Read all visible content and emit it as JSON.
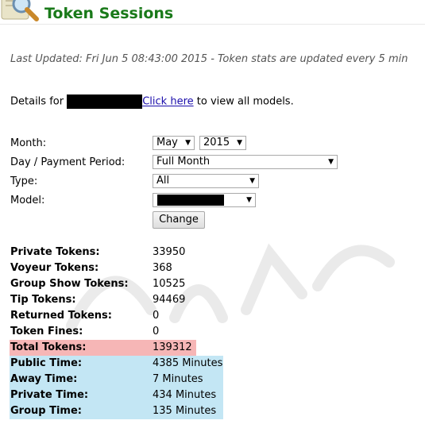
{
  "header": {
    "title": "Token Sessions",
    "icon": "magnifier-icon"
  },
  "last_updated": "Last Updated: Fri Jun 5 08:43:00 2015 - Token stats are updated every 5 min",
  "details": {
    "prefix": "Details for",
    "link_text": "Click here",
    "suffix": " to view all models."
  },
  "form": {
    "month_label": "Month:",
    "month_value": "May",
    "year_value": "2015",
    "period_label": "Day / Payment Period:",
    "period_value": "Full Month",
    "type_label": "Type:",
    "type_value": "All",
    "model_label": "Model:",
    "change_label": "Change"
  },
  "stats": [
    {
      "label": "Private Tokens:",
      "value": "33950"
    },
    {
      "label": "Voyeur Tokens:",
      "value": "368"
    },
    {
      "label": "Group Show Tokens:",
      "value": "10525"
    },
    {
      "label": "Tip Tokens:",
      "value": "94469"
    },
    {
      "label": "Returned Tokens:",
      "value": "0"
    },
    {
      "label": "Token Fines:",
      "value": "0"
    },
    {
      "label": "Total Tokens:",
      "value": "139312"
    },
    {
      "label": "Public Time:",
      "value": "4385 Minutes"
    },
    {
      "label": "Away Time:",
      "value": "7 Minutes"
    },
    {
      "label": "Private Time:",
      "value": "434 Minutes"
    },
    {
      "label": "Group Time:",
      "value": "135 Minutes"
    }
  ],
  "colors": {
    "title_green": "#1a7a1a",
    "total_highlight": "#f6b6b6",
    "time_highlight": "#c3e6f4",
    "link": "#1a0dab"
  }
}
